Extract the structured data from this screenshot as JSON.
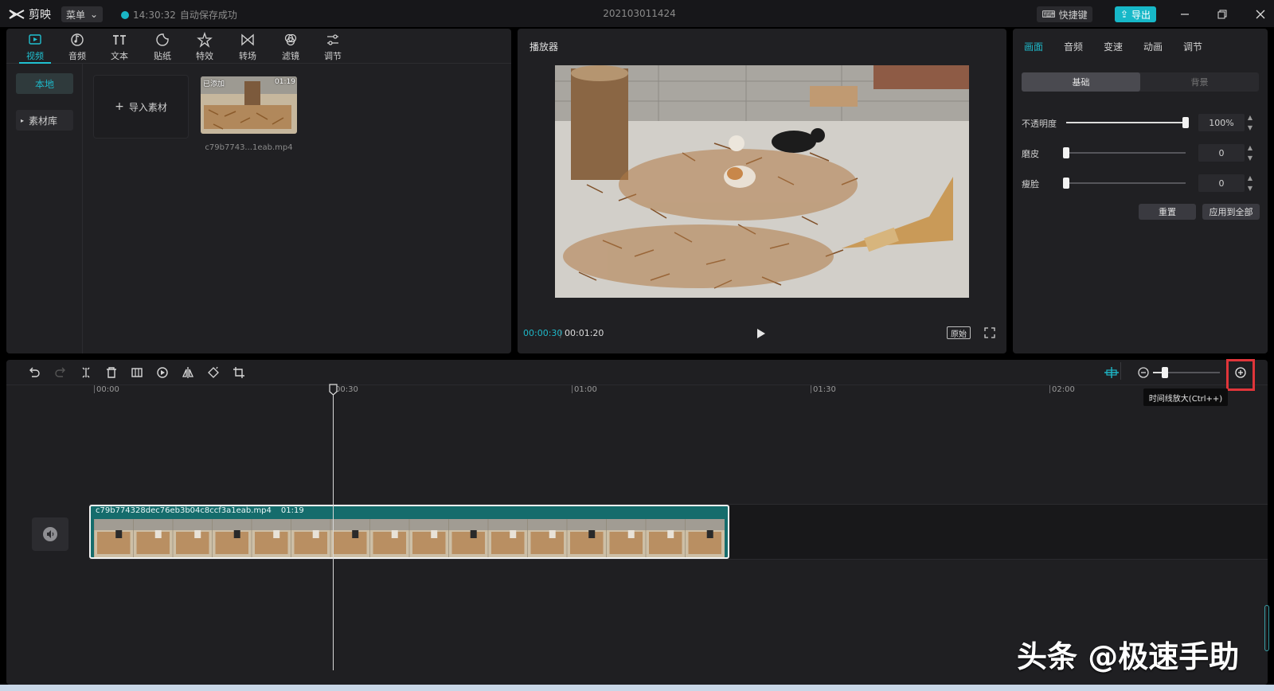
{
  "app": {
    "name": "剪映",
    "menu_label": "菜单",
    "autosave_time": "14:30:32",
    "autosave_text": "自动保存成功",
    "project_title": "202103011424",
    "shortcut_label": "快捷键",
    "export_label": "导出"
  },
  "media": {
    "tools": [
      {
        "label": "视频",
        "icon": "video-icon"
      },
      {
        "label": "音频",
        "icon": "audio-icon"
      },
      {
        "label": "文本",
        "icon": "text-icon"
      },
      {
        "label": "贴纸",
        "icon": "sticker-icon"
      },
      {
        "label": "特效",
        "icon": "effects-icon"
      },
      {
        "label": "转场",
        "icon": "transition-icon"
      },
      {
        "label": "滤镜",
        "icon": "filter-icon"
      },
      {
        "label": "调节",
        "icon": "adjust-icon"
      }
    ],
    "sidebar": {
      "local": "本地",
      "library": "素材库"
    },
    "import_label": "导入素材",
    "item": {
      "badge": "已添加",
      "duration": "01:19",
      "name": "c79b7743...1eab.mp4"
    }
  },
  "player": {
    "title": "播放器",
    "current": "00:00:30",
    "total": "00:01:20",
    "ratio_label": "原始"
  },
  "props": {
    "tabs": [
      "画面",
      "音频",
      "变速",
      "动画",
      "调节"
    ],
    "seg_basic": "基础",
    "seg_bg": "背景",
    "opacity": {
      "label": "不透明度",
      "value": "100%",
      "level": 1.0
    },
    "smooth": {
      "label": "磨皮",
      "value": "0",
      "level": 0
    },
    "slim": {
      "label": "瘦脸",
      "value": "0",
      "level": 0
    },
    "reset_label": "重置",
    "apply_all_label": "应用到全部"
  },
  "timeline": {
    "ruler": [
      "00:00",
      "00:30",
      "01:00",
      "01:30",
      "02:00"
    ],
    "clip": {
      "name": "c79b774328dec76eb3b04c8ccf3a1eab.mp4",
      "duration": "01:19"
    },
    "tooltip": "时间线放大(Ctrl++)",
    "zoom_level": 0.18
  },
  "watermark": "头条 @极速手助",
  "colors": {
    "accent": "#1eb8c8",
    "highlight": "#e0353a",
    "clip": "#156c6c"
  }
}
